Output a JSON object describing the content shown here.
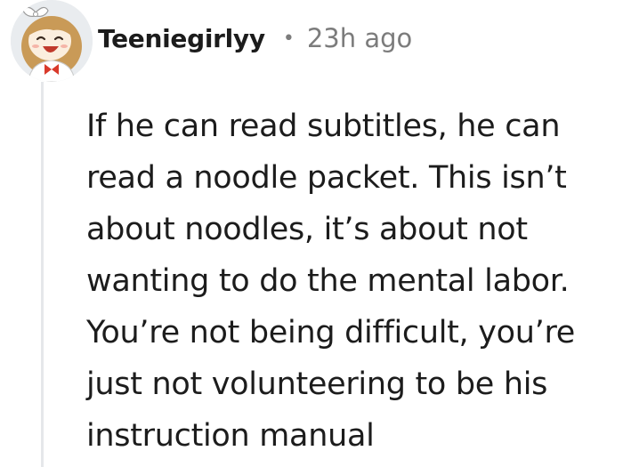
{
  "comment": {
    "username": "Teeniegirlyy",
    "separator": "•",
    "timestamp": "23h ago",
    "avatar_icon": "cartoon-girl-avatar-icon",
    "lines": [
      "If he can read subtitles, he can",
      "read a noodle packet. This isn’t",
      "about noodles, it’s about not",
      "wanting to do the mental labor.",
      "You’re not being difficult, you’re",
      "just not volunteering to be his",
      "instruction manual"
    ]
  },
  "colors": {
    "text": "#1c1c1c",
    "meta": "#7c7c7c",
    "thread_line": "#e5e7ea",
    "avatar_bg": "#e9ecef"
  }
}
